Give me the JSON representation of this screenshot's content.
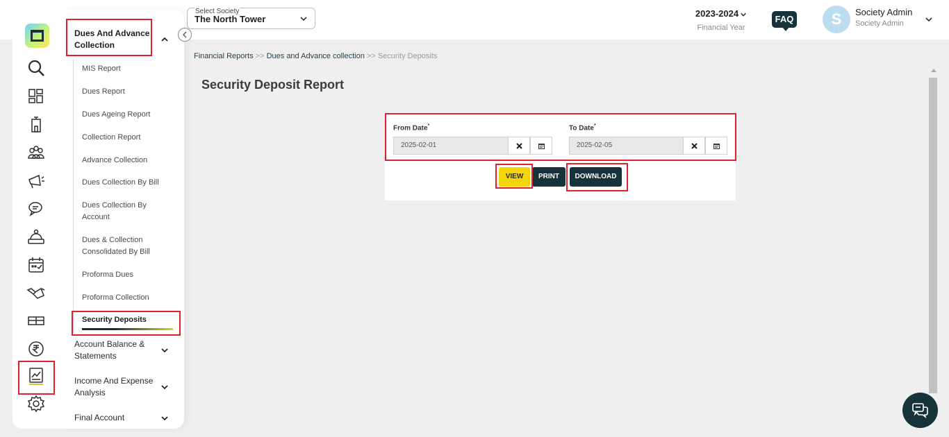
{
  "header": {
    "society_label": "Select Society",
    "society_value": "The North Tower",
    "financial_year": "2023-2024",
    "financial_year_caption": "Financial Year",
    "faq_label": "FAQ",
    "avatar_initial": "S",
    "user_name": "Society Admin",
    "user_role": "Society Admin"
  },
  "rail_icons": [
    "logo-icon",
    "search-icon",
    "dashboard-icon",
    "building-icon",
    "members-icon",
    "announcement-icon",
    "chat-icon",
    "helpdesk-icon",
    "calendar-icon",
    "handshake-icon",
    "parcel-icon",
    "rupee-icon",
    "reports-icon",
    "settings-icon"
  ],
  "sidebar": {
    "section_active": "Dues And Advance Collection",
    "items": [
      {
        "label": "MIS Report"
      },
      {
        "label": "Dues Report"
      },
      {
        "label": "Dues Ageing Report"
      },
      {
        "label": "Collection Report"
      },
      {
        "label": "Advance Collection"
      },
      {
        "label": "Dues Collection By Bill"
      },
      {
        "label": "Dues Collection By Account"
      },
      {
        "label": "Dues & Collection Consolidated By Bill"
      },
      {
        "label": "Proforma Dues"
      },
      {
        "label": "Proforma Collection"
      },
      {
        "label": "Security Deposits"
      }
    ],
    "sections": [
      {
        "label": "Account Balance & Statements"
      },
      {
        "label": "Income And Expense Analysis"
      },
      {
        "label": "Final Account"
      }
    ]
  },
  "breadcrumb": {
    "part1": "Financial Reports",
    "sep": ">>",
    "part2": "Dues and Advance collection",
    "part3": "Security Deposits"
  },
  "page": {
    "title": "Security Deposit Report"
  },
  "form": {
    "from_label": "From Date",
    "from_value": "2025-02-01",
    "to_label": "To Date",
    "to_value": "2025-02-05",
    "required_mark": "*"
  },
  "buttons": {
    "view": "VIEW",
    "print": "PRINT",
    "download": "DOWNLOAD"
  },
  "colors": {
    "accent_dark": "#16323a",
    "accent_yellow": "#f3d50a",
    "highlight_red": "#e0212b"
  }
}
